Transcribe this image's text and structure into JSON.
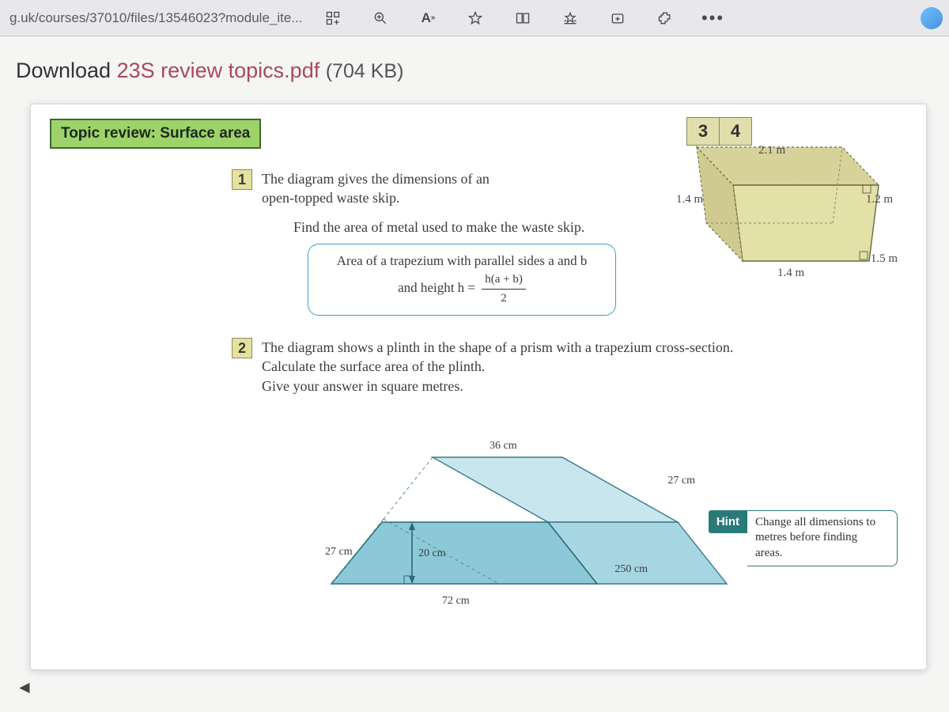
{
  "browser": {
    "url_fragment": "g.uk/courses/37010/files/13546023?module_ite...",
    "icons": [
      "grid-icon",
      "zoom-icon",
      "read-aloud-icon",
      "star-icon",
      "split-icon",
      "favorites-icon",
      "collections-icon",
      "extensions-icon",
      "more-icon"
    ]
  },
  "download": {
    "prefix": "Download ",
    "filename": "23S review topics.pdf",
    "size": "(704 KB)"
  },
  "topic_label": "Topic review: Surface area",
  "tabs": [
    "3",
    "4"
  ],
  "q1": {
    "num": "1",
    "text_a": "The diagram gives the dimensions of an",
    "text_b": "open-topped waste skip.",
    "sub": "Find the area of metal used to make the waste skip.",
    "formula_line1": "Area of a trapezium with parallel sides a and b",
    "formula_line2_prefix": "and height h =",
    "formula_num": "h(a + b)",
    "formula_den": "2"
  },
  "skip": {
    "top_back": "2.1 m",
    "left": "1.4 m",
    "right": "1.2 m",
    "bottom_front": "1.4 m",
    "bottom_right": "1.5 m"
  },
  "q2": {
    "num": "2",
    "line1": "The diagram shows a plinth in the shape of a prism with a trapezium cross-section.",
    "line2": "Calculate the surface area of the plinth.",
    "line3": "Give your answer in square metres."
  },
  "prism": {
    "top": "36 cm",
    "right_depth": "27 cm",
    "length": "250 cm",
    "slant": "27 cm",
    "height": "20 cm",
    "base": "72 cm"
  },
  "hint": {
    "badge": "Hint",
    "text": "Change all dimensions to metres before finding areas."
  }
}
